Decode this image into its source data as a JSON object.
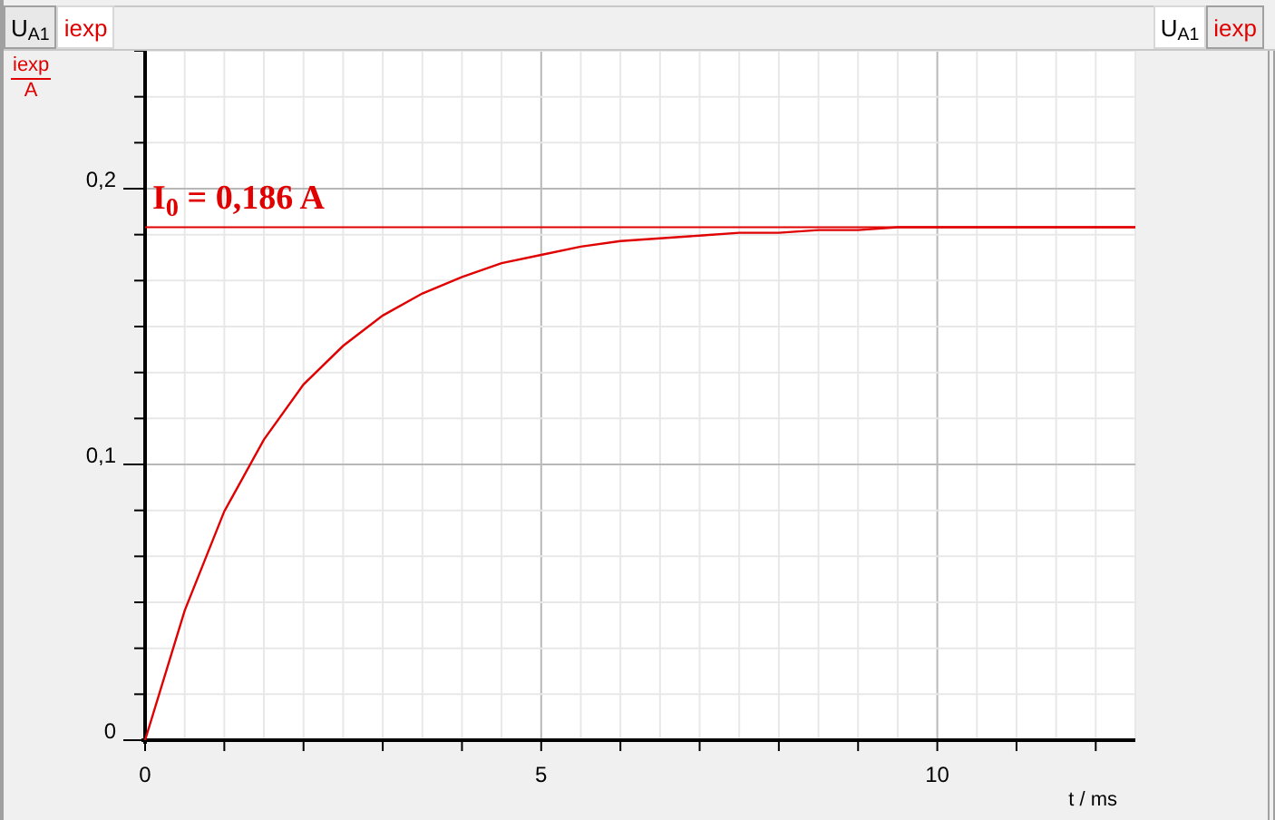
{
  "left_tabs": [
    {
      "label": "U$_{A1}$",
      "color": "#000000",
      "selected": false
    },
    {
      "label": "iexp",
      "color": "#e00000",
      "selected": true
    }
  ],
  "right_tabs": [
    {
      "label": "U$_{A1}$",
      "color": "#000000",
      "selected": true
    },
    {
      "label": "iexp",
      "color": "#e00000",
      "selected": false
    }
  ],
  "y_axis_label": {
    "quantity": "iexp",
    "unit": "A"
  },
  "chart_data": {
    "type": "line",
    "xlabel": "t / ms",
    "x": [
      0,
      0.5,
      1,
      1.5,
      2,
      2.5,
      3,
      3.5,
      4,
      4.5,
      5,
      5.5,
      6,
      6.5,
      7,
      7.5,
      8,
      8.5,
      9,
      9.5,
      10,
      10.5,
      11,
      11.5,
      12,
      12.5
    ],
    "series": [
      {
        "color": "#e00000",
        "values": [
          0,
          0.047,
          0.083,
          0.109,
          0.129,
          0.143,
          0.154,
          0.162,
          0.168,
          0.173,
          0.176,
          0.179,
          0.181,
          0.182,
          0.183,
          0.184,
          0.184,
          0.185,
          0.185,
          0.186,
          0.186,
          0.186,
          0.186,
          0.186,
          0.186,
          0.186
        ]
      }
    ],
    "xlim": [
      0,
      12.5
    ],
    "ylim": [
      0,
      0.25
    ],
    "xticks": [
      0,
      5,
      10
    ],
    "yticks": [
      {
        "value": 0,
        "label": "0"
      },
      {
        "value": 0.1,
        "label": "0,1"
      },
      {
        "value": 0.2,
        "label": "0,2"
      }
    ],
    "grid": true,
    "ref_lines": [
      {
        "axis": "y",
        "value": 0.186,
        "color": "#e00000",
        "label": "I$_{0}$ = 0,186 A"
      }
    ]
  }
}
